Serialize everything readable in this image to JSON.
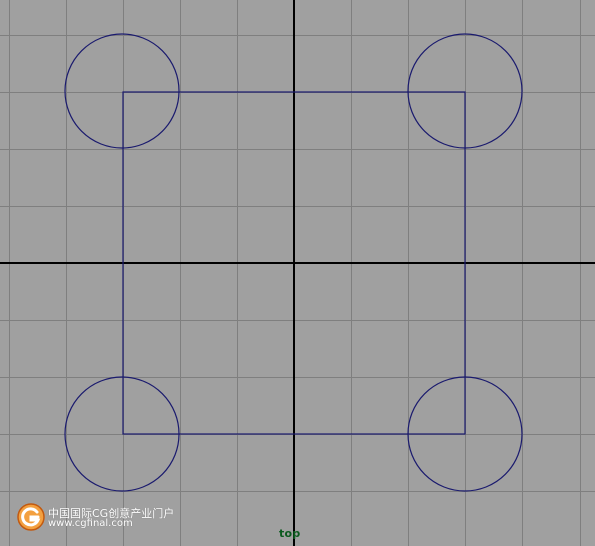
{
  "viewport": {
    "camera_name": "top",
    "background_color": "#a0a0a0",
    "grid_color": "#7f7f7f",
    "axis_color": "#000000",
    "curve_color": "#1a1a6e",
    "camera_label_color": "#0b5a1e"
  },
  "scene": {
    "square_curve": "rectangle",
    "circle_curves": [
      "circle-top-left",
      "circle-top-right",
      "circle-bottom-left",
      "circle-bottom-right"
    ]
  },
  "watermark": {
    "title": "中国国际CG创意产业门户",
    "url": "www.cgfinal.com",
    "logo_icon": "g-logo-icon",
    "logo_color": "#e07020"
  }
}
